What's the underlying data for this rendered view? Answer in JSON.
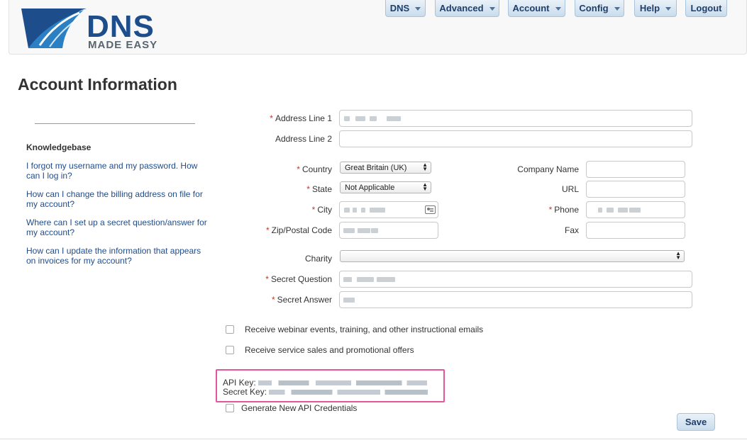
{
  "brand": {
    "logo_main": "DNS",
    "logo_sub": "MADE EASY",
    "accent": "#1e3f6b",
    "logo_blue": "#1a7fc1"
  },
  "nav": {
    "items": [
      "DNS",
      "Advanced",
      "Account",
      "Config",
      "Help",
      "Logout"
    ]
  },
  "page": {
    "title": "Account Information"
  },
  "sidebar": {
    "heading": "Knowledgebase",
    "links": [
      "I forgot my username and my password. How can I log in?",
      "How can I change the billing address on file for my account?",
      "Where can I set up a secret question/answer for my account?",
      "How can I update the information that appears on invoices for my account?"
    ]
  },
  "form": {
    "required_mark": "*",
    "address1_label": "Address Line 1",
    "address2_label": "Address Line 2",
    "country_label": "Country",
    "country_value": "Great Britain (UK)",
    "state_label": "State",
    "state_value": "Not Applicable",
    "city_label": "City",
    "zip_label": "Zip/Postal Code",
    "company_label": "Company Name",
    "url_label": "URL",
    "phone_label": "Phone",
    "fax_label": "Fax",
    "charity_label": "Charity",
    "charity_value": "",
    "secret_question_label": "Secret Question",
    "secret_answer_label": "Secret Answer",
    "opt_webinar": "Receive webinar events, training, and other instructional emails",
    "opt_sales": "Receive service sales and promotional offers",
    "api_key_label": "API Key:",
    "secret_key_label": "Secret Key:",
    "generate_label": "Generate New API Credentials",
    "save_label": "Save"
  },
  "colors": {
    "required": "#c0392b",
    "link": "#1f4c8a",
    "highlight_border": "#e3569b"
  }
}
